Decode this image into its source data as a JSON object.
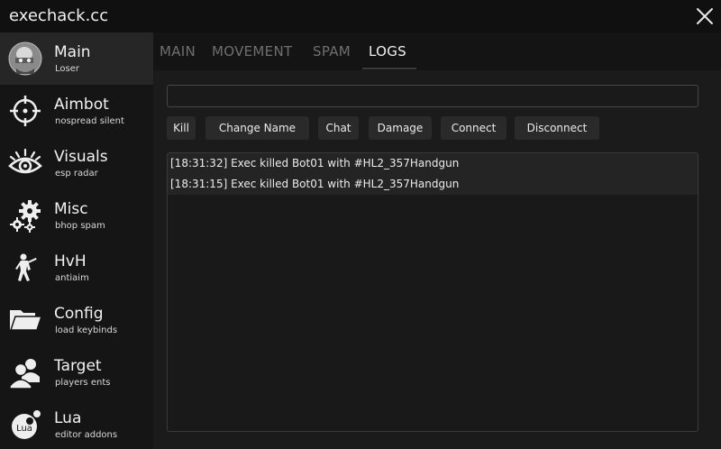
{
  "app": {
    "title": "exechack.cc"
  },
  "sidebar": {
    "items": [
      {
        "label": "Main",
        "sub": "Loser"
      },
      {
        "label": "Aimbot",
        "sub": "nospread silent"
      },
      {
        "label": "Visuals",
        "sub": "esp radar"
      },
      {
        "label": "Misc",
        "sub": "bhop spam"
      },
      {
        "label": "HvH",
        "sub": "antiaim"
      },
      {
        "label": "Config",
        "sub": "load keybinds"
      },
      {
        "label": "Target",
        "sub": "players ents"
      },
      {
        "label": "Lua",
        "sub": "editor addons"
      }
    ],
    "active": "Main",
    "lua_icon_text": "Lua"
  },
  "tabs": [
    {
      "label": "MAIN"
    },
    {
      "label": "MOVEMENT"
    },
    {
      "label": "SPAM"
    },
    {
      "label": "LOGS"
    }
  ],
  "active_tab": "LOGS",
  "search": {
    "value": "",
    "placeholder": ""
  },
  "filters": [
    {
      "label": "Kill"
    },
    {
      "label": "Change Name"
    },
    {
      "label": "Chat"
    },
    {
      "label": "Damage"
    },
    {
      "label": "Connect"
    },
    {
      "label": "Disconnect"
    }
  ],
  "logs": [
    {
      "text": "[18:31:32] Exec killed Bot01 with #HL2_357Handgun"
    },
    {
      "text": "[18:31:15] Exec killed Bot01 with #HL2_357Handgun"
    }
  ],
  "colors": {
    "background": "#141414",
    "sidebar_active": "#262626",
    "content": "#1b1b1b",
    "button": "#2a2a2a",
    "log_row": "#242424"
  }
}
